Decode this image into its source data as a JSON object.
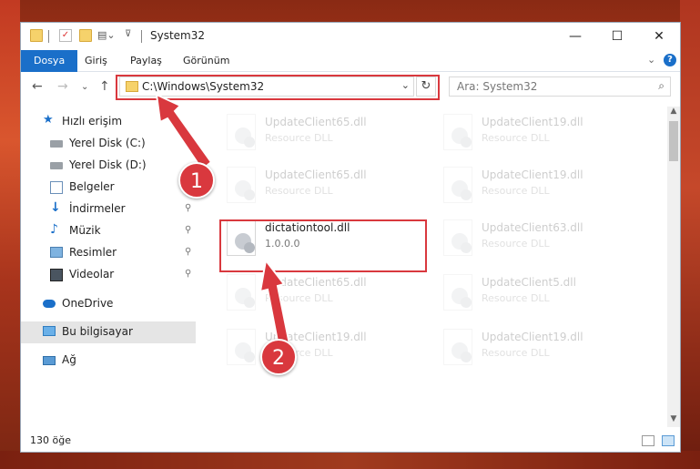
{
  "window": {
    "title": "System32",
    "minimize": "—",
    "maximize": "☐",
    "close": "✕"
  },
  "ribbon": {
    "tabs": [
      "Dosya",
      "Giriş",
      "Paylaş",
      "Görünüm"
    ],
    "expand": "⌄",
    "help": "?"
  },
  "nav": {
    "back": "←",
    "forward": "→",
    "recent": "⌄",
    "up": "↑",
    "address": "C:\\Windows\\System32",
    "address_dropdown": "⌄",
    "refresh": "↻",
    "search_placeholder": "Ara: System32",
    "search_icon": "⌕"
  },
  "sidebar": {
    "items": [
      {
        "label": "Hızlı erişim",
        "icon": "star-icon"
      },
      {
        "label": "Yerel Disk (C:)",
        "icon": "drive-icon",
        "pinned": true
      },
      {
        "label": "Yerel Disk (D:)",
        "icon": "drive-icon",
        "pinned": true
      },
      {
        "label": "Belgeler",
        "icon": "documents-icon",
        "pinned": true
      },
      {
        "label": "İndirmeler",
        "icon": "downloads-icon",
        "pinned": true
      },
      {
        "label": "Müzik",
        "icon": "music-icon",
        "pinned": true
      },
      {
        "label": "Resimler",
        "icon": "pictures-icon",
        "pinned": true
      },
      {
        "label": "Videolar",
        "icon": "videos-icon",
        "pinned": true
      },
      {
        "label": "OneDrive",
        "icon": "cloud-icon"
      },
      {
        "label": "Bu bilgisayar",
        "icon": "computer-icon",
        "selected": true
      },
      {
        "label": "Ağ",
        "icon": "network-icon"
      }
    ],
    "pin_glyph": "⚲"
  },
  "files": [
    {
      "name": "UpdateClient65.dll",
      "sub": "Resource DLL"
    },
    {
      "name": "UpdateClient19.dll",
      "sub": "Resource DLL"
    },
    {
      "name": "UpdateClient65.dll",
      "sub": "Resource DLL"
    },
    {
      "name": "UpdateClient19.dll",
      "sub": "Resource DLL"
    },
    {
      "name": "dictationtool.dll",
      "sub": "1.0.0.0"
    },
    {
      "name": "UpdateClient63.dll",
      "sub": "Resource DLL"
    },
    {
      "name": "UpdateClient65.dll",
      "sub": "Resource DLL"
    },
    {
      "name": "UpdateClient5.dll",
      "sub": "Resource DLL"
    },
    {
      "name": "UpdateClient19.dll",
      "sub": "Resource DLL"
    },
    {
      "name": "UpdateClient19.dll",
      "sub": "Resource DLL"
    }
  ],
  "status": {
    "count": "130 öğe"
  },
  "callouts": [
    "1",
    "2"
  ],
  "colors": {
    "accent": "#1a6fc9",
    "highlight": "#d9383e"
  }
}
